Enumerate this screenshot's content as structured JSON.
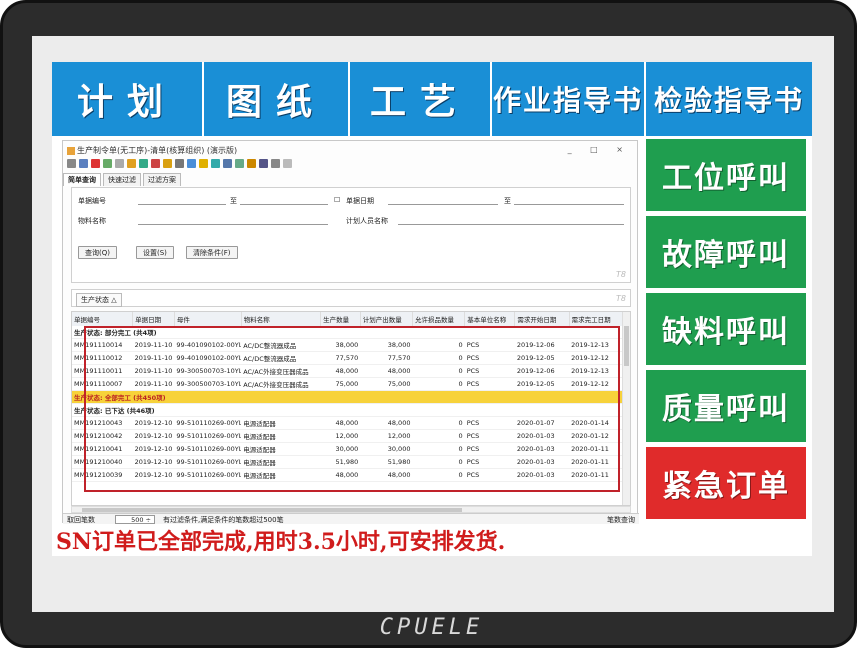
{
  "brand": "CPUELE",
  "top_buttons": [
    "计划",
    "图纸",
    "工艺",
    "作业指导书",
    "检验指导书"
  ],
  "side_buttons": [
    "工位呼叫",
    "故障呼叫",
    "缺料呼叫",
    "质量呼叫",
    "紧急订单"
  ],
  "colors": {
    "blue": "#1a8fd6",
    "green": "#1f9e4f",
    "red": "#e02b2b",
    "highlight": "#f7d23a",
    "message": "#d01c1c"
  },
  "erp": {
    "title": "生产制令单(无工序)-清单(核算组织) (演示版)",
    "window_controls": "_ □ ×",
    "tabs": [
      "简单查询",
      "快速过滤",
      "过滤方案"
    ],
    "query": {
      "doc_no_label": "单据编号",
      "to_label": "至",
      "doc_date_label": "单据日期",
      "to_label2": "至",
      "material_label": "物料名称",
      "planner_label": "计划人员名称",
      "btn_query": "查询(Q)",
      "btn_settings": "设置(S)",
      "btn_clear": "清除条件(F)",
      "tag": "T8"
    },
    "group_bar": {
      "chip": "生产状态 △",
      "tag": "T8"
    },
    "columns": [
      "单据编号",
      "单据日期",
      "母件",
      "物料名称",
      "生产数量",
      "计划产出数量",
      "允许损品数量",
      "基本单位名称",
      "需求开始日期",
      "需求完工日期"
    ],
    "groups": [
      {
        "label": "生产状态: 部分完工 (共4项)",
        "highlight": false,
        "rows": [
          [
            "MM191110014",
            "2019-11-10",
            "99-401090102-00YL",
            "AC/DC整流器成品",
            "38,000",
            "38,000",
            "0",
            "PCS",
            "2019-12-06",
            "2019-12-13"
          ],
          [
            "MM191110012",
            "2019-11-10",
            "99-401090102-00YL",
            "AC/DC整流器成品",
            "77,570",
            "77,570",
            "0",
            "PCS",
            "2019-12-05",
            "2019-12-12"
          ],
          [
            "MM191110011",
            "2019-11-10",
            "99-300500703-10YL",
            "AC/AC外接变压器成品",
            "48,000",
            "48,000",
            "0",
            "PCS",
            "2019-12-06",
            "2019-12-13"
          ],
          [
            "MM191110007",
            "2019-11-10",
            "99-300500703-10YL",
            "AC/AC外接变压器成品",
            "75,000",
            "75,000",
            "0",
            "PCS",
            "2019-12-05",
            "2019-12-12"
          ]
        ]
      },
      {
        "label": "生产状态: 全部完工 (共450项)",
        "highlight": true,
        "rows": []
      },
      {
        "label": "生产状态: 已下达 (共46项)",
        "highlight": false,
        "rows": [
          [
            "MM191210043",
            "2019-12-10",
            "99-510110269-00YL",
            "电源适配器",
            "48,000",
            "48,000",
            "0",
            "PCS",
            "2020-01-07",
            "2020-01-14"
          ],
          [
            "MM191210042",
            "2019-12-10",
            "99-510110269-00YL",
            "电源适配器",
            "12,000",
            "12,000",
            "0",
            "PCS",
            "2020-01-03",
            "2020-01-12"
          ],
          [
            "MM191210041",
            "2019-12-10",
            "99-510110269-00YL",
            "电源适配器",
            "30,000",
            "30,000",
            "0",
            "PCS",
            "2020-01-03",
            "2020-01-11"
          ],
          [
            "MM191210040",
            "2019-12-10",
            "99-510110269-00YL",
            "电源适配器",
            "51,980",
            "51,980",
            "0",
            "PCS",
            "2020-01-03",
            "2020-01-11"
          ],
          [
            "MM191210039",
            "2019-12-10",
            "99-510110269-00YL",
            "电源适配器",
            "48,000",
            "48,000",
            "0",
            "PCS",
            "2020-01-03",
            "2020-01-11"
          ]
        ]
      }
    ],
    "status": {
      "left_label": "取回笔数",
      "page_value": "500 ÷",
      "info": "有过滤条件,满足条件的笔数超过500笔",
      "right_label": "笔数查询"
    }
  },
  "message": "SN订单已全部完成,用时3.5小时,可安排发货."
}
